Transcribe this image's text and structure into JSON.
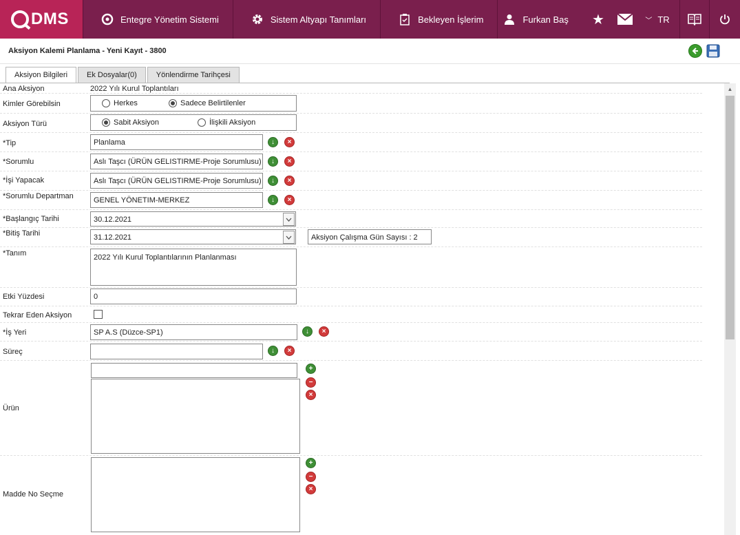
{
  "nav": {
    "logo": "DMS",
    "items": [
      {
        "label": "Entegre Yönetim Sistemi"
      },
      {
        "label": "Sistem Altyapı Tanımları"
      },
      {
        "label": "Bekleyen İşlerim"
      },
      {
        "label": "Furkan Baş"
      }
    ],
    "language": "TR"
  },
  "page": {
    "title": "Aksiyon Kalemi Planlama - Yeni Kayıt - 3800"
  },
  "tabs": [
    "Aksiyon Bilgileri",
    "Ek Dosyalar(0)",
    "Yönlendirme Tarihçesi"
  ],
  "form": {
    "ana_aksiyon": {
      "label": "Ana Aksiyon",
      "value": "2022 Yılı Kurul Toplantıları"
    },
    "kimler": {
      "label": "Kimler Görebilsin",
      "options": [
        "Herkes",
        "Sadece Belirtilenler"
      ],
      "selected": "Sadece Belirtilenler"
    },
    "tur": {
      "label": "Aksiyon Türü",
      "options": [
        "Sabit Aksiyon",
        "İlişkili Aksiyon"
      ],
      "selected": "Sabit Aksiyon"
    },
    "tip": {
      "label": "*Tip",
      "value": "Planlama"
    },
    "sorumlu": {
      "label": "*Sorumlu",
      "value": "Aslı Taşcı (ÜRÜN GELISTIRME-Proje Sorumlusu)"
    },
    "isi_yapacak": {
      "label": "*İşi Yapacak",
      "value": "Aslı Taşcı (ÜRÜN GELISTIRME-Proje Sorumlusu)"
    },
    "departman": {
      "label": "*Sorumlu Departman",
      "value": "GENEL YÖNETIM-MERKEZ"
    },
    "baslangic": {
      "label": "*Başlangıç Tarihi",
      "value": "30.12.2021"
    },
    "bitis": {
      "label": "*Bitiş Tarihi",
      "value": "31.12.2021"
    },
    "gun_sayisi": "Aksiyon Çalışma Gün Sayısı : 2",
    "tanim": {
      "label": "*Tanım",
      "value": "2022 Yılı Kurul Toplantılarının Planlanması"
    },
    "etki": {
      "label": "Etki Yüzdesi",
      "value": "0"
    },
    "tekrar": {
      "label": "Tekrar Eden Aksiyon",
      "checked": false
    },
    "is_yeri": {
      "label": "*İş Yeri",
      "value": "SP A.S (Düzce-SP1)"
    },
    "surec": {
      "label": "Süreç",
      "value": ""
    },
    "urun": {
      "label": "Ürün",
      "value": ""
    },
    "madde": {
      "label": "Madde No Seçme"
    }
  },
  "colors": {
    "nav_bg": "#7a1f4d",
    "logo_bg": "#b82457",
    "add": "#3f8f36",
    "remove": "#d23b3b"
  }
}
